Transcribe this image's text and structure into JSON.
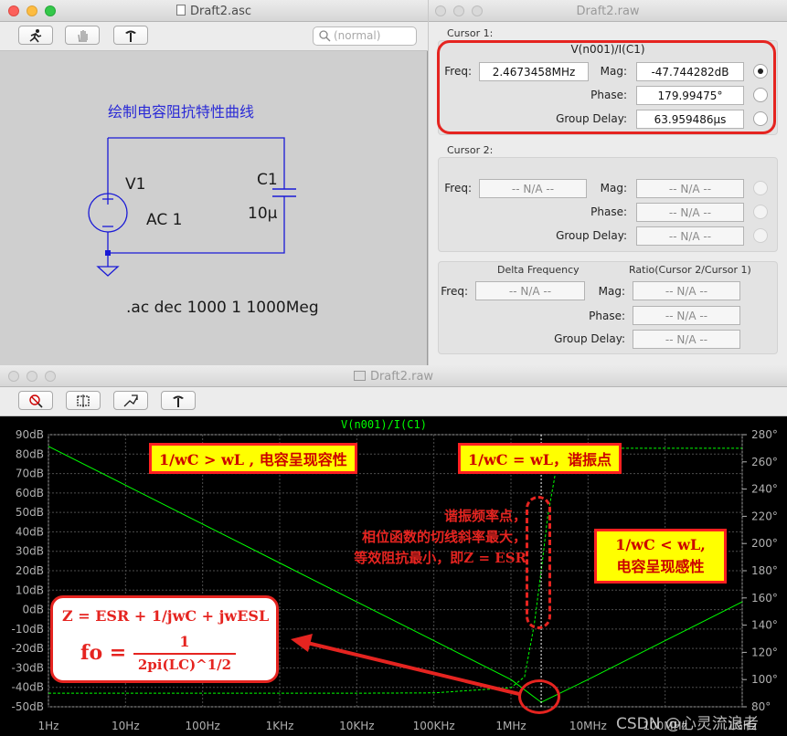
{
  "schematic_window": {
    "title": "Draft2.asc",
    "search_placeholder": "(normal)",
    "title_text": "绘制电容阻抗特性曲线",
    "source_name": "V1",
    "source_value": "AC 1",
    "cap_name": "C1",
    "cap_value": "10µ",
    "directive": ".ac dec 1000 1 1000Meg"
  },
  "cursor_window": {
    "title": "Draft2.raw",
    "cursor1": {
      "group_label": "Cursor 1:",
      "trace_name": "V(n001)/I(C1)",
      "freq_label": "Freq:",
      "freq": "2.4673458MHz",
      "mag_label": "Mag:",
      "mag": "-47.744282dB",
      "phase_label": "Phase:",
      "phase": "179.99475°",
      "gd_label": "Group Delay:",
      "group_delay": "63.959486µs"
    },
    "cursor2": {
      "group_label": "Cursor 2:",
      "freq_label": "Freq:",
      "mag_label": "Mag:",
      "phase_label": "Phase:",
      "gd_label": "Group Delay:",
      "na": "-- N/A --"
    },
    "delta": {
      "delta_freq_label": "Delta Frequency",
      "ratio_label": "Ratio(Cursor 2/Cursor 1)",
      "freq_label": "Freq:",
      "mag_label": "Mag:",
      "phase_label": "Phase:",
      "gd_label": "Group Delay:",
      "na": "-- N/A --"
    }
  },
  "wave_window": {
    "title": "Draft2.raw",
    "trace_label": "V(n001)/I(C1)",
    "watermark": "CSDN @心灵流浪者",
    "annotations": {
      "capacitive": "1/wC > wL , 电容呈现容性",
      "resonance": "1/wC = wL，谐振点",
      "inductive_line1": "1/wC < wL,",
      "inductive_line2": "电容呈现感性",
      "resonance_note_line1": "谐振频率点，",
      "resonance_note_line2": "相位函数的切线斜率最大，",
      "resonance_note_line3": "等效阻抗最小，即Z = ESR",
      "formula_z": "Z = ESR + 1/jwC + jwESL",
      "formula_fo_lhs": "fo =",
      "formula_fo_num": "1",
      "formula_fo_den": "2pi(LC)^1/2"
    }
  },
  "colors": {
    "trace": "#00ff00",
    "phase_trace": "#00ff00",
    "grid": "#4d4d4d",
    "axis_text": "#b0b0b0",
    "annotation_bg": "#ffff00",
    "annotation_border": "#ff2020",
    "annotation_text": "#cc0000",
    "callout": "#e52420"
  },
  "chart_data": {
    "type": "line",
    "title": "V(n001)/I(C1)",
    "x_scale": "log",
    "x_unit": "Hz",
    "xlim": [
      1,
      1000000000
    ],
    "x_ticks": [
      "1Hz",
      "10Hz",
      "100Hz",
      "1KHz",
      "10KHz",
      "100KHz",
      "1MHz",
      "10MHz",
      "100MHz",
      "1GHz"
    ],
    "ylim_left": [
      -50,
      90
    ],
    "y_ticks_left": [
      "90dB",
      "80dB",
      "70dB",
      "60dB",
      "50dB",
      "40dB",
      "30dB",
      "20dB",
      "10dB",
      "0dB",
      "-10dB",
      "-20dB",
      "-30dB",
      "-40dB",
      "-50dB"
    ],
    "ylim_right": [
      80,
      280
    ],
    "y_ticks_right": [
      "280°",
      "260°",
      "240°",
      "220°",
      "200°",
      "180°",
      "160°",
      "140°",
      "120°",
      "100°",
      "80°"
    ],
    "grid": true,
    "cursor_x": 2467345.8,
    "series": [
      {
        "name": "Mag",
        "axis": "left",
        "style": "solid",
        "x": [
          1,
          10,
          100,
          1000,
          10000,
          100000,
          1000000,
          2467345.8,
          10000000,
          100000000,
          1000000000
        ],
        "y": [
          84,
          64,
          44,
          24,
          4,
          -16,
          -36,
          -47.7,
          -36,
          -16,
          4
        ]
      },
      {
        "name": "Phase",
        "axis": "right",
        "style": "dashed",
        "x": [
          1,
          10000,
          100000,
          1000000,
          1500000,
          2000000,
          2467345.8,
          3000000,
          4000000,
          6000000,
          1000000000
        ],
        "y": [
          90,
          90,
          90.2,
          94,
          102,
          140,
          180,
          220,
          260,
          270,
          270
        ]
      }
    ]
  }
}
